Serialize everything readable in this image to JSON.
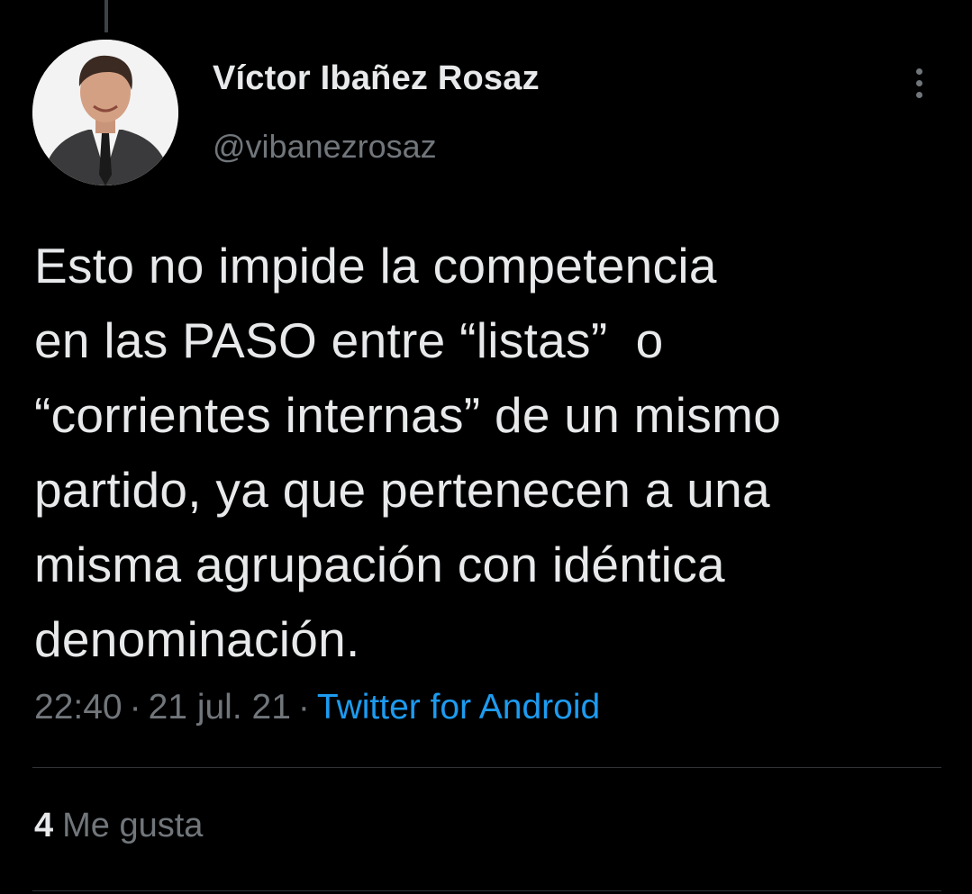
{
  "author": {
    "display_name": "Víctor Ibañez Rosaz",
    "handle": "@vibanezrosaz"
  },
  "tweet": {
    "text": "Esto no impide la competencia\nen las PASO entre “listas”  o\n“corrientes internas” de un mismo\npartido, ya que pertenecen a una\nmisma agrupación con idéntica\ndenominación.",
    "time": "22:40",
    "date": "21 jul. 21",
    "separator": "·",
    "source": "Twitter for Android"
  },
  "stats": {
    "likes_count": "4",
    "likes_label": "Me gusta"
  },
  "icons": {
    "more": "more-vertical-icon"
  },
  "colors": {
    "background": "#000000",
    "text_primary": "#e7e9ea",
    "text_secondary": "#71767b",
    "link": "#1d9bf0",
    "divider": "#2f3336"
  }
}
